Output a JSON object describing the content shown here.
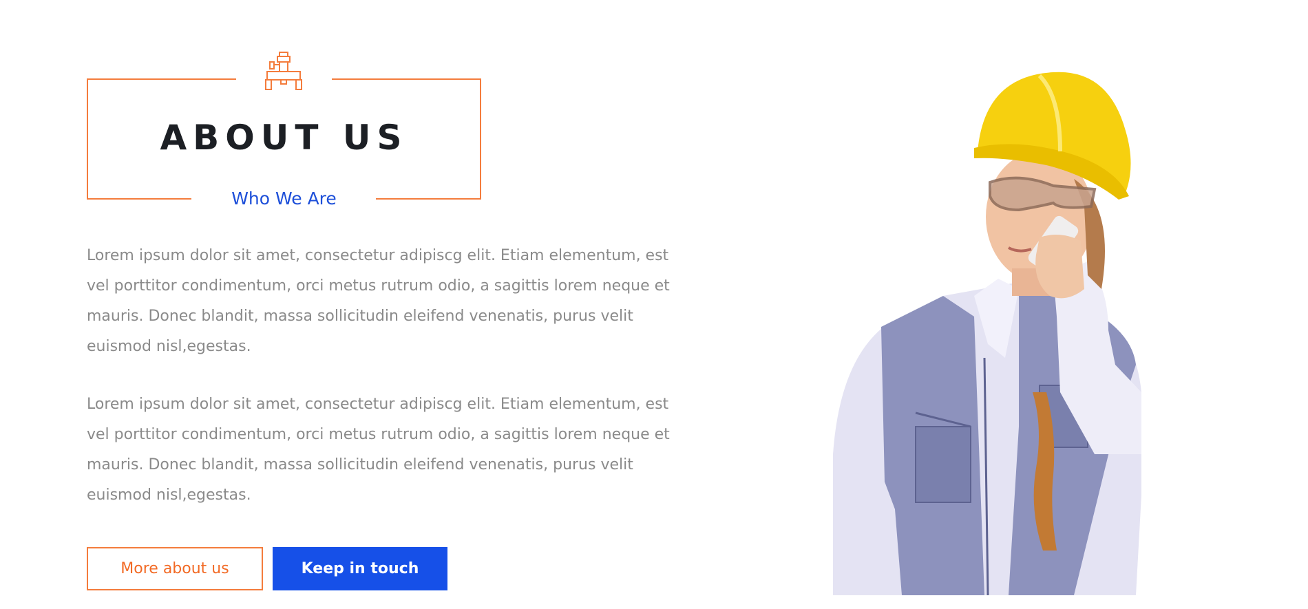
{
  "section": {
    "title": "ABOUT US",
    "subtitle": "Who We Are",
    "paragraphs": [
      "Lorem ipsum dolor sit amet, consectetur adipiscg elit. Etiam elementum, est vel porttitor condimentum, orci metus rutrum odio, a sagittis lorem neque et mauris. Donec blandit, massa sollicitudin eleifend venenatis, purus velit euismod nisl,egestas.",
      "Lorem ipsum dolor sit amet, consectetur adipiscg elit. Etiam elementum, est vel porttitor condimentum, orci metus rutrum odio, a sagittis lorem neque et mauris. Donec blandit, massa sollicitudin eleifend venenatis, purus velit euismod nisl,egestas."
    ],
    "icon": "pipe-valve-icon",
    "image": "worker-with-hard-hat-on-phone"
  },
  "buttons": {
    "more_label": "More about us",
    "contact_label": "Keep in touch"
  },
  "colors": {
    "accent_orange": "#f47c3c",
    "accent_blue": "#1650e8",
    "heading": "#1c1f24",
    "body_text": "#8a8a8a"
  }
}
